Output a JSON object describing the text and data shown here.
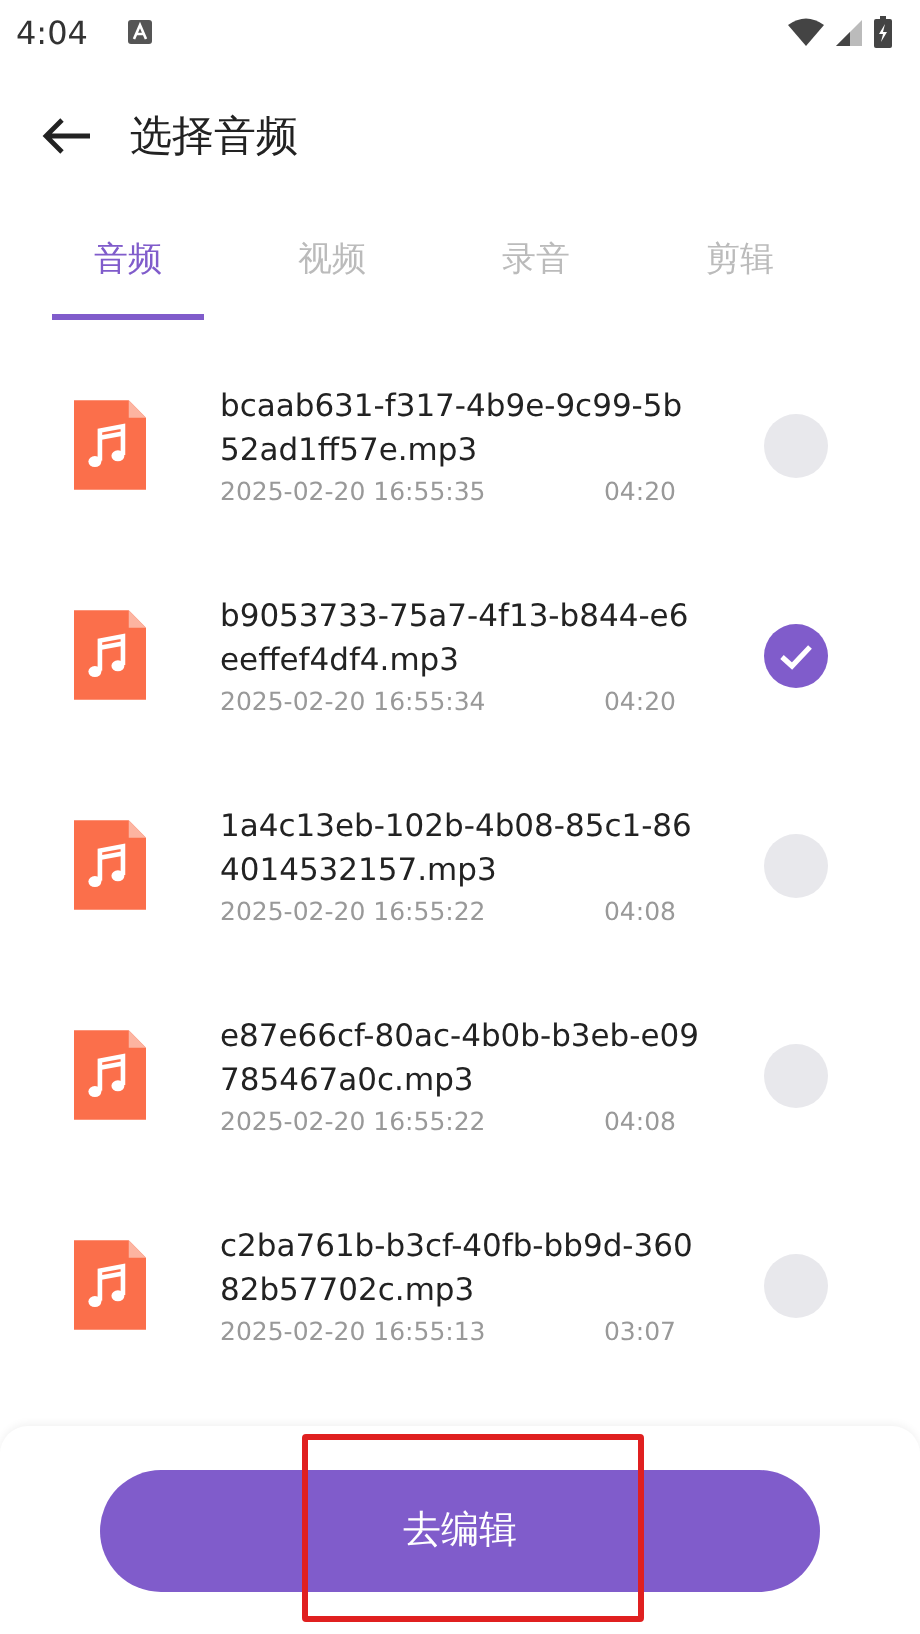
{
  "status_bar": {
    "time": "4:04"
  },
  "header": {
    "title": "选择音频"
  },
  "tabs": [
    {
      "label": "音频",
      "selected": true
    },
    {
      "label": "视频",
      "selected": false
    },
    {
      "label": "录音",
      "selected": false
    },
    {
      "label": "剪辑",
      "selected": false
    }
  ],
  "files": [
    {
      "name": "bcaab631-f317-4b9e-9c99-5b52ad1ff57e.mp3",
      "date": "2025-02-20 16:55:35",
      "duration": "04:20",
      "selected": false
    },
    {
      "name": "b9053733-75a7-4f13-b844-e6eeffef4df4.mp3",
      "date": "2025-02-20 16:55:34",
      "duration": "04:20",
      "selected": true
    },
    {
      "name": "1a4c13eb-102b-4b08-85c1-864014532157.mp3",
      "date": "2025-02-20 16:55:22",
      "duration": "04:08",
      "selected": false
    },
    {
      "name": "e87e66cf-80ac-4b0b-b3eb-e09785467a0c.mp3",
      "date": "2025-02-20 16:55:22",
      "duration": "04:08",
      "selected": false
    },
    {
      "name": "c2ba761b-b3cf-40fb-bb9d-36082b57702c.mp3",
      "date": "2025-02-20 16:55:13",
      "duration": "03:07",
      "selected": false
    }
  ],
  "action_button": {
    "label": "去编辑",
    "highlighted": true
  }
}
